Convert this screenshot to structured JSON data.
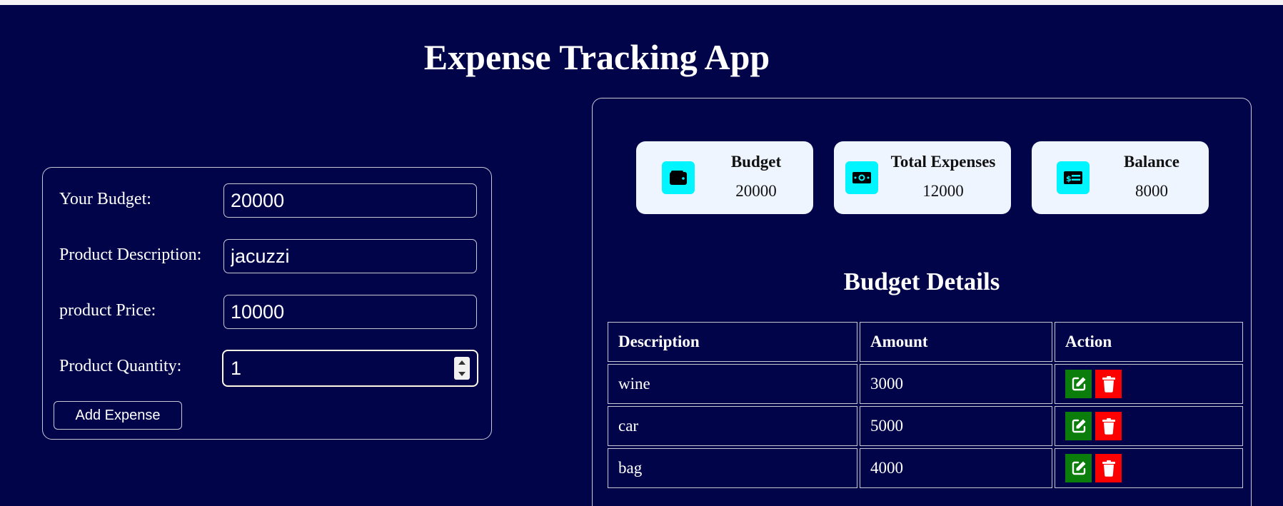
{
  "app": {
    "title": "Expense Tracking App"
  },
  "form": {
    "budget_label": "Your Budget:",
    "budget_value": "20000",
    "description_label": "Product Description:",
    "description_value": "jacuzzi",
    "price_label": "product Price:",
    "price_value": "10000",
    "quantity_label": "Product Quantity:",
    "quantity_value": "1",
    "add_button_label": "Add Expense"
  },
  "summary": {
    "cards": [
      {
        "title": "Budget",
        "value": "20000",
        "icon": "wallet-icon"
      },
      {
        "title": "Total Expenses",
        "value": "12000",
        "icon": "money-bill-icon"
      },
      {
        "title": "Balance",
        "value": "8000",
        "icon": "money-check-icon"
      }
    ],
    "icon_color": "#00f5ff",
    "card_color": "#eef5ff"
  },
  "details": {
    "title": "Budget Details",
    "headers": [
      "Description",
      "Amount",
      "Action"
    ],
    "rows": [
      {
        "description": "wine",
        "amount": "3000"
      },
      {
        "description": "car",
        "amount": "5000"
      },
      {
        "description": "bag",
        "amount": "4000"
      }
    ],
    "edit_icon": "edit-icon",
    "delete_icon": "trash-icon",
    "edit_color": "#0a7d0a",
    "delete_color": "#ff0000"
  },
  "theme": {
    "background": "#02044a",
    "text": "#ffffff"
  }
}
